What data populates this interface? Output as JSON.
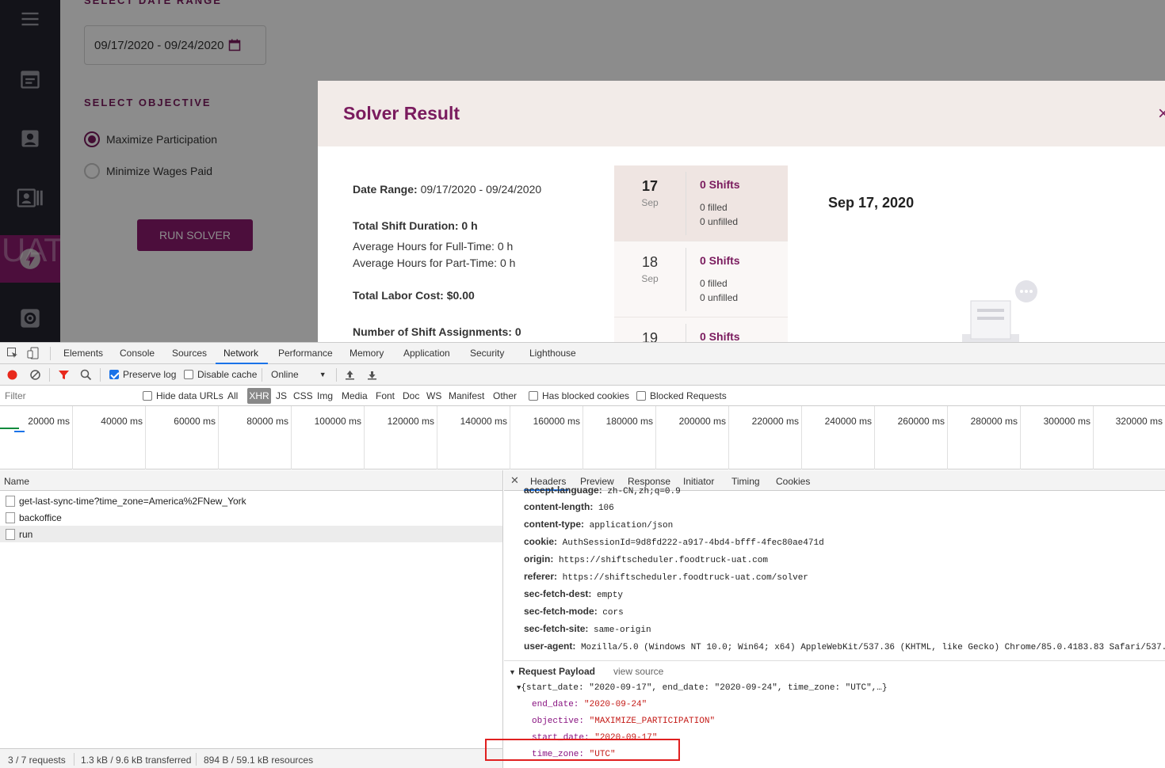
{
  "app": {
    "sidebar": {
      "items": [
        {
          "icon": "menu-icon"
        },
        {
          "icon": "calendar-icon"
        },
        {
          "icon": "user-card-icon"
        },
        {
          "icon": "id-card-list-icon"
        },
        {
          "icon": "lightning-icon",
          "active": true,
          "env_label": "UAT"
        },
        {
          "icon": "gear-icon"
        }
      ]
    },
    "date_section_label": "SELECT DATE RANGE",
    "date_range_value": "09/17/2020 - 09/24/2020",
    "objective_label": "SELECT OBJECTIVE",
    "objectives": [
      {
        "label": "Maximize Participation",
        "selected": true
      },
      {
        "label": "Minimize Wages Paid",
        "selected": false
      }
    ],
    "run_button": "RUN SOLVER",
    "accent_color": "#7a1b5e"
  },
  "modal": {
    "title": "Solver Result",
    "close": "×",
    "date_range_label": "Date Range:",
    "date_range_value": "09/17/2020 - 09/24/2020",
    "total_duration": "Total Shift Duration: 0 h",
    "avg_full": "Average Hours for Full-Time: 0 h",
    "avg_part": "Average Hours for Part-Time: 0 h",
    "total_cost": "Total Labor Cost: $0.00",
    "assignments": "Number of Shift Assignments: 0",
    "days": [
      {
        "num": "17",
        "month": "Sep",
        "shifts": "0 Shifts",
        "filled": "0 filled",
        "unfilled": "0 unfilled",
        "selected": true
      },
      {
        "num": "18",
        "month": "Sep",
        "shifts": "0 Shifts",
        "filled": "0 filled",
        "unfilled": "0 unfilled",
        "selected": false
      },
      {
        "num": "19",
        "month": "Sep",
        "shifts": "0 Shifts",
        "filled": "",
        "unfilled": "",
        "selected": false
      }
    ],
    "selected_date": "Sep 17, 2020"
  },
  "devtools": {
    "tabs": [
      "Elements",
      "Console",
      "Sources",
      "Network",
      "Performance",
      "Memory",
      "Application",
      "Security",
      "Lighthouse"
    ],
    "active_tab": "Network",
    "toolbar": {
      "preserve_log": "Preserve log",
      "disable_cache": "Disable cache",
      "throttle": "Online"
    },
    "filter": {
      "placeholder": "Filter",
      "hide_data_urls": "Hide data URLs",
      "types": [
        "All",
        "XHR",
        "JS",
        "CSS",
        "Img",
        "Media",
        "Font",
        "Doc",
        "WS",
        "Manifest",
        "Other"
      ],
      "active_type": "XHR",
      "has_blocked_cookies": "Has blocked cookies",
      "blocked_requests": "Blocked Requests"
    },
    "timeline_ticks": [
      "20000 ms",
      "40000 ms",
      "60000 ms",
      "80000 ms",
      "100000 ms",
      "120000 ms",
      "140000 ms",
      "160000 ms",
      "180000 ms",
      "200000 ms",
      "220000 ms",
      "240000 ms",
      "260000 ms",
      "280000 ms",
      "300000 ms",
      "320000 ms"
    ],
    "requests": {
      "header": "Name",
      "rows": [
        "get-last-sync-time?time_zone=America%2FNew_York",
        "backoffice",
        "run"
      ],
      "selected": 2,
      "status": [
        "3 / 7 requests",
        "1.3 kB / 9.6 kB transferred",
        "894 B / 59.1 kB resources"
      ]
    },
    "detail": {
      "tabs": [
        "Headers",
        "Preview",
        "Response",
        "Initiator",
        "Timing",
        "Cookies"
      ],
      "active_tab": "Headers",
      "headers": [
        {
          "k": "accept-language:",
          "v": "zh-CN,zh;q=0.9"
        },
        {
          "k": "content-length:",
          "v": "106"
        },
        {
          "k": "content-type:",
          "v": "application/json"
        },
        {
          "k": "cookie:",
          "v": "AuthSessionId=9d8fd222-a917-4bd4-bfff-4fec80ae471d"
        },
        {
          "k": "origin:",
          "v": "https://shiftscheduler.foodtruck-uat.com"
        },
        {
          "k": "referer:",
          "v": "https://shiftscheduler.foodtruck-uat.com/solver"
        },
        {
          "k": "sec-fetch-dest:",
          "v": "empty"
        },
        {
          "k": "sec-fetch-mode:",
          "v": "cors"
        },
        {
          "k": "sec-fetch-site:",
          "v": "same-origin"
        },
        {
          "k": "user-agent:",
          "v": "Mozilla/5.0 (Windows NT 10.0; Win64; x64) AppleWebKit/537.36 (KHTML, like Gecko) Chrome/85.0.4183.83 Safari/537."
        }
      ],
      "payload_title": "Request Payload",
      "view_source": "view source",
      "payload_summary": "{start_date: \"2020-09-17\", end_date: \"2020-09-24\", time_zone: \"UTC\",…}",
      "payload_fields": [
        {
          "k": "end_date:",
          "v": "\"2020-09-24\""
        },
        {
          "k": "objective:",
          "v": "\"MAXIMIZE_PARTICIPATION\""
        },
        {
          "k": "start_date:",
          "v": "\"2020-09-17\""
        },
        {
          "k": "time_zone:",
          "v": "\"UTC\""
        }
      ]
    }
  }
}
